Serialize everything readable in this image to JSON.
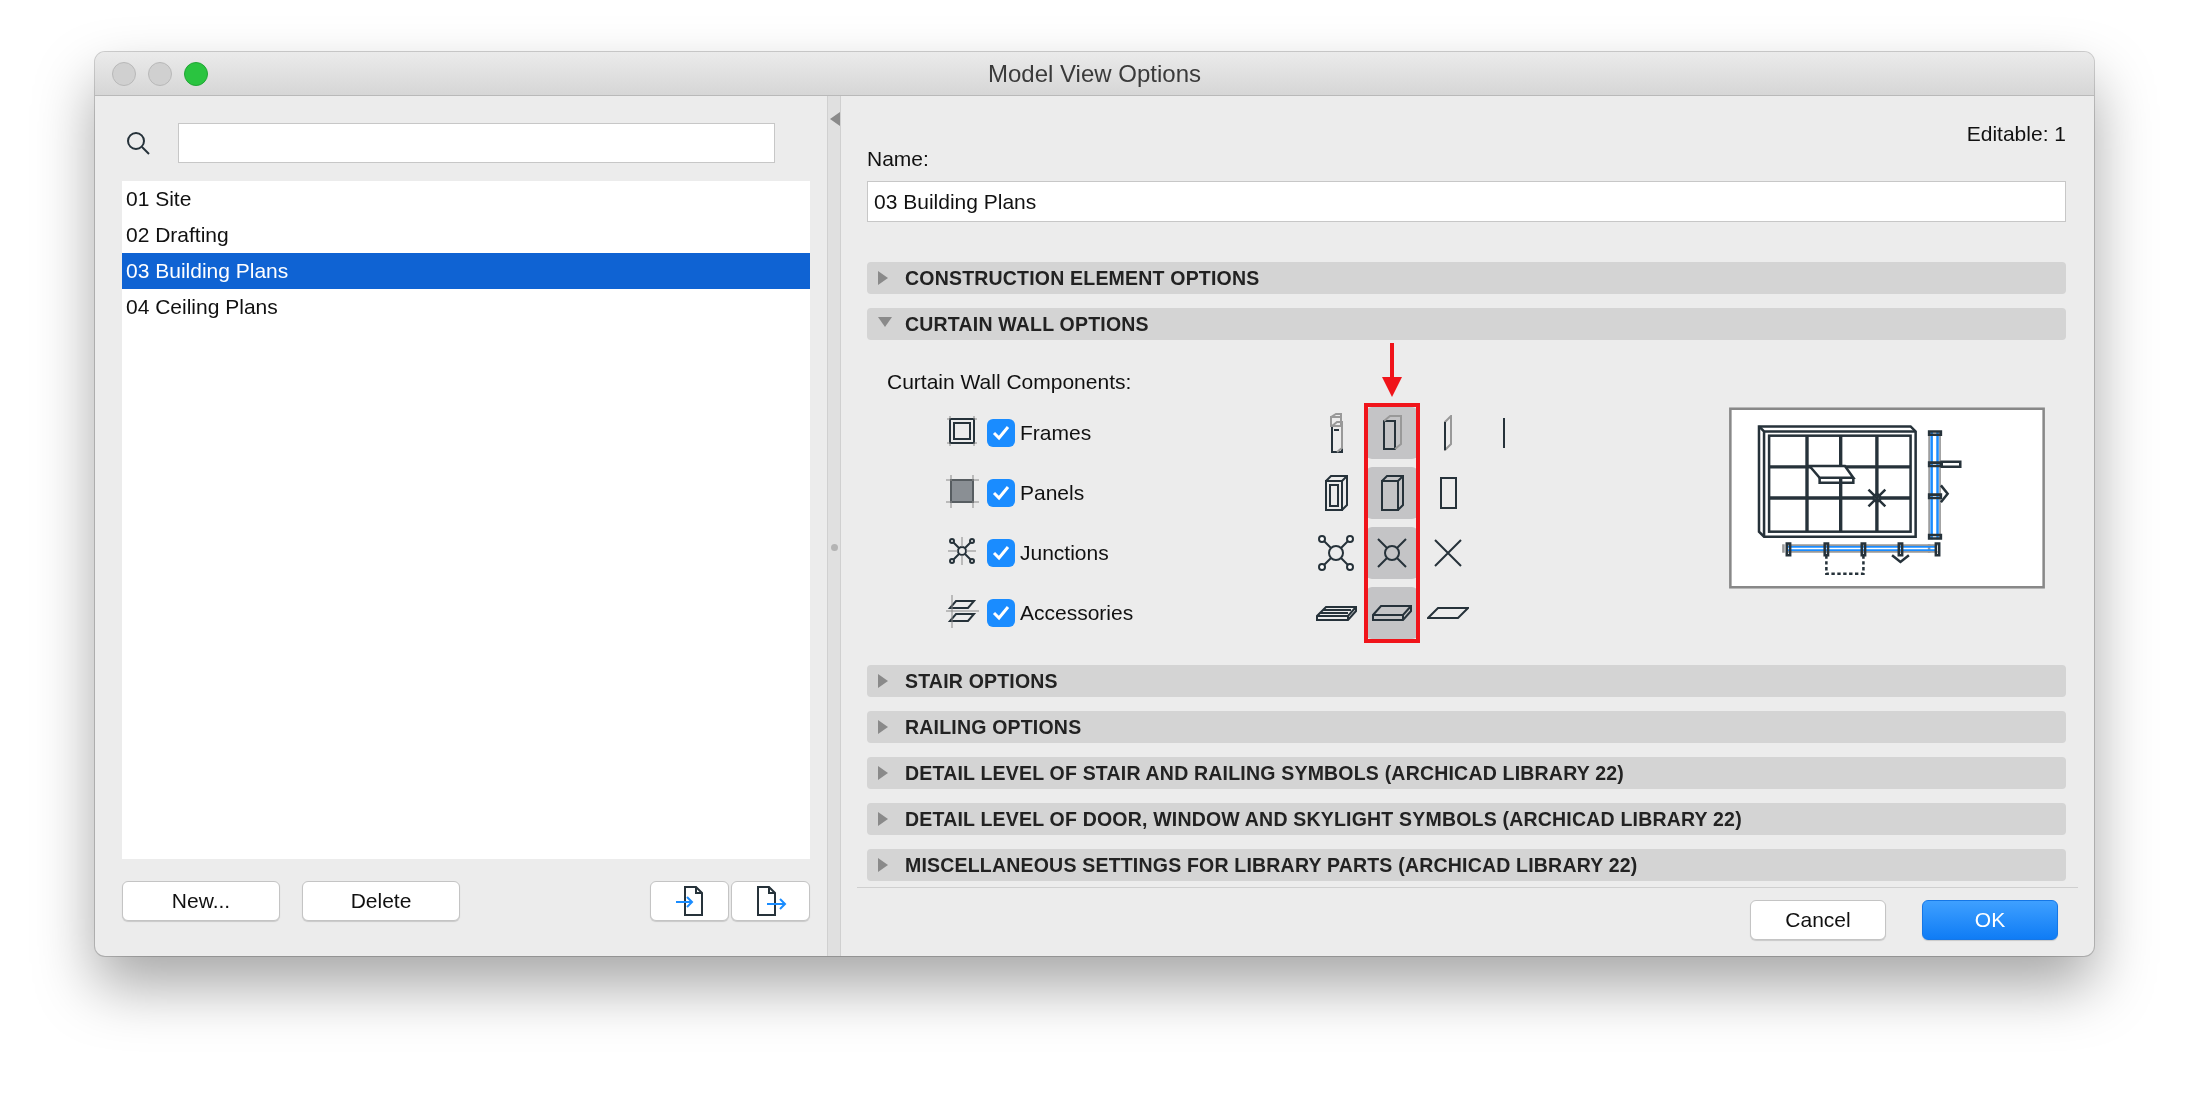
{
  "window": {
    "title": "Model View Options"
  },
  "sidebar": {
    "items": [
      {
        "label": "01 Site",
        "selected": false
      },
      {
        "label": "02 Drafting",
        "selected": false
      },
      {
        "label": "03 Building Plans",
        "selected": true
      },
      {
        "label": "04 Ceiling Plans",
        "selected": false
      }
    ],
    "buttons": [
      "New...",
      "Delete"
    ]
  },
  "editable": "Editable: 1",
  "name": {
    "label": "Name:",
    "value": "03 Building Plans"
  },
  "sections": [
    {
      "title": "CONSTRUCTION ELEMENT OPTIONS",
      "expanded": false
    },
    {
      "title": "CURTAIN WALL OPTIONS",
      "expanded": true,
      "content": {
        "heading": "Curtain Wall Components:",
        "components": [
          {
            "label": "Frames",
            "checked": true,
            "options": [
              {
                "selected": false
              },
              {
                "selected": true
              },
              {
                "selected": false
              },
              {
                "selected": false
              }
            ]
          },
          {
            "label": "Panels",
            "checked": true,
            "options": [
              {
                "selected": false
              },
              {
                "selected": true
              },
              {
                "selected": false
              }
            ]
          },
          {
            "label": "Junctions",
            "checked": true,
            "options": [
              {
                "selected": false
              },
              {
                "selected": true
              },
              {
                "selected": false
              }
            ]
          },
          {
            "label": "Accessories",
            "checked": true,
            "options": [
              {
                "selected": false
              },
              {
                "selected": true
              },
              {
                "selected": false
              }
            ]
          }
        ]
      }
    },
    {
      "title": "STAIR OPTIONS",
      "expanded": false
    },
    {
      "title": "RAILING OPTIONS",
      "expanded": false
    },
    {
      "title": "DETAIL LEVEL OF STAIR AND RAILING SYMBOLS (ARCHICAD LIBRARY 22)",
      "expanded": false
    },
    {
      "title": "DETAIL LEVEL OF DOOR, WINDOW AND SKYLIGHT SYMBOLS (ARCHICAD LIBRARY 22)",
      "expanded": false
    },
    {
      "title": "MISCELLANEOUS SETTINGS FOR LIBRARY PARTS (ARCHICAD LIBRARY 22)",
      "expanded": false
    }
  ],
  "footer": {
    "buttons": [
      {
        "label": "Cancel",
        "kind": "secondary"
      },
      {
        "label": "OK",
        "kind": "default"
      }
    ]
  }
}
